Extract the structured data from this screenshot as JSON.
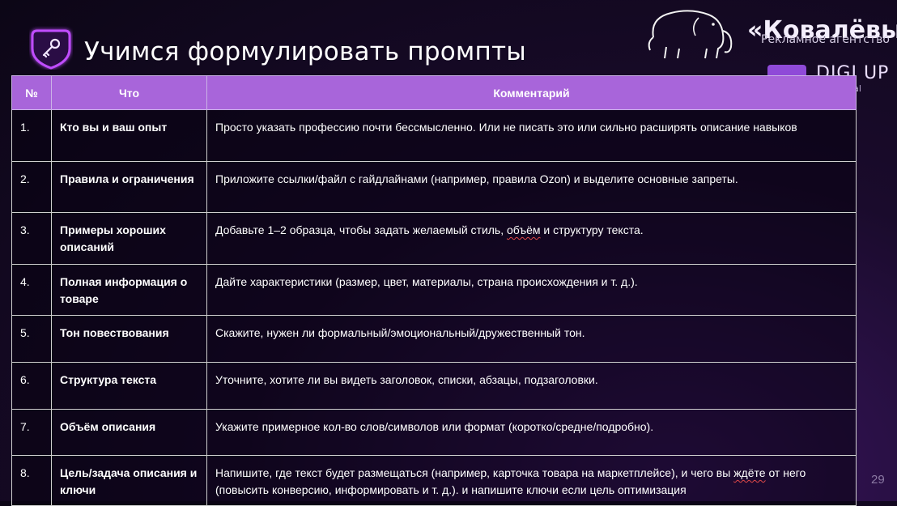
{
  "title": "Учимся формулировать промпты",
  "brand": {
    "name": "«Ковалёвы»",
    "subtitle": "Рекламное агентство",
    "partner": "DIGI UP",
    "partner_tagline": "our digital\nng skills"
  },
  "table": {
    "headers": [
      "№",
      "Что",
      "Комментарий"
    ],
    "rows": [
      {
        "num": "1.",
        "what": "Кто вы и ваш опыт",
        "comment": "Просто указать профессию почти бессмысленно. Или не писать это или сильно расширять описание навыков"
      },
      {
        "num": "2.",
        "what": "Правила и ограничения",
        "comment": "Приложите ссылки/файл с гайдлайнами (например, правила Ozon) и выделите основные запреты."
      },
      {
        "num": "3.",
        "what": "Примеры хороших описаний",
        "comment_pre": "Добавьте 1–2 образца, чтобы задать желаемый стиль, ",
        "comment_mark": "объём",
        "comment_post": " и структуру текста."
      },
      {
        "num": "4.",
        "what": "Полная информация о товаре",
        "comment": "Дайте характеристики (размер, цвет, материалы, страна происхождения и т. д.)."
      },
      {
        "num": "5.",
        "what": "Тон повествования",
        "comment": "Скажите, нужен ли формальный/эмоциональный/дружественный тон."
      },
      {
        "num": "6.",
        "what": "Структура текста",
        "comment": "Уточните, хотите ли вы видеть заголовок, списки, абзацы, подзаголовки."
      },
      {
        "num": "7.",
        "what": "Объём описания",
        "comment": "Укажите примерное кол-во слов/символов или формат (коротко/средне/подробно)."
      },
      {
        "num": "8.",
        "what": "Цель/задача описания и ключи",
        "comment_pre": "Напишите, где текст будет размещаться (например, карточка товара на маркетплейсе), и чего вы ",
        "comment_mark": "ждёте",
        "comment_post": " от него (повысить конверсию, информировать и т. д.). и напишите ключи если цель оптимизация"
      }
    ]
  },
  "slide_number": "29",
  "colors": {
    "header_bg": "#a865da",
    "accent": "#8f4ad8",
    "background": "#1a0b2c"
  }
}
